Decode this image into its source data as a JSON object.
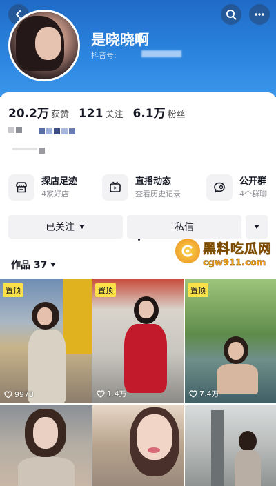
{
  "header": {
    "nickname": "是晓晓啊",
    "douyin_id_label": "抖音号:",
    "icons": [
      "back-icon",
      "search-icon",
      "more-icon"
    ],
    "background_color": "#2c86e0"
  },
  "stats": [
    {
      "value": "20.2万",
      "label": "获赞"
    },
    {
      "value": "121",
      "label": "关注"
    },
    {
      "value": "6.1万",
      "label": "粉丝"
    }
  ],
  "features": [
    {
      "title": "探店足迹",
      "subtitle": "4家好店",
      "icon": "store-icon"
    },
    {
      "title": "直播动态",
      "subtitle": "查看历史记录",
      "icon": "live-icon"
    },
    {
      "title": "公开群",
      "subtitle": "4个群聊",
      "icon": "chat-icon"
    }
  ],
  "actions": {
    "followed_label": "已关注",
    "message_label": "私信"
  },
  "works": {
    "label": "作品 37",
    "pinned_label": "置顶",
    "videos": [
      {
        "pinned": true,
        "likes": "9973"
      },
      {
        "pinned": true,
        "likes": "1.4万"
      },
      {
        "pinned": true,
        "likes": "7.4万"
      },
      {
        "pinned": false,
        "likes": ""
      },
      {
        "pinned": false,
        "likes": ""
      },
      {
        "pinned": false,
        "likes": ""
      }
    ]
  },
  "watermark": {
    "title": "黑料吃瓜网",
    "url": "cgw911.com"
  },
  "colors": {
    "accent_yellow": "#fce249",
    "text_primary": "#161823",
    "text_secondary": "#8a8b91",
    "button_bg": "#f2f2f4"
  }
}
